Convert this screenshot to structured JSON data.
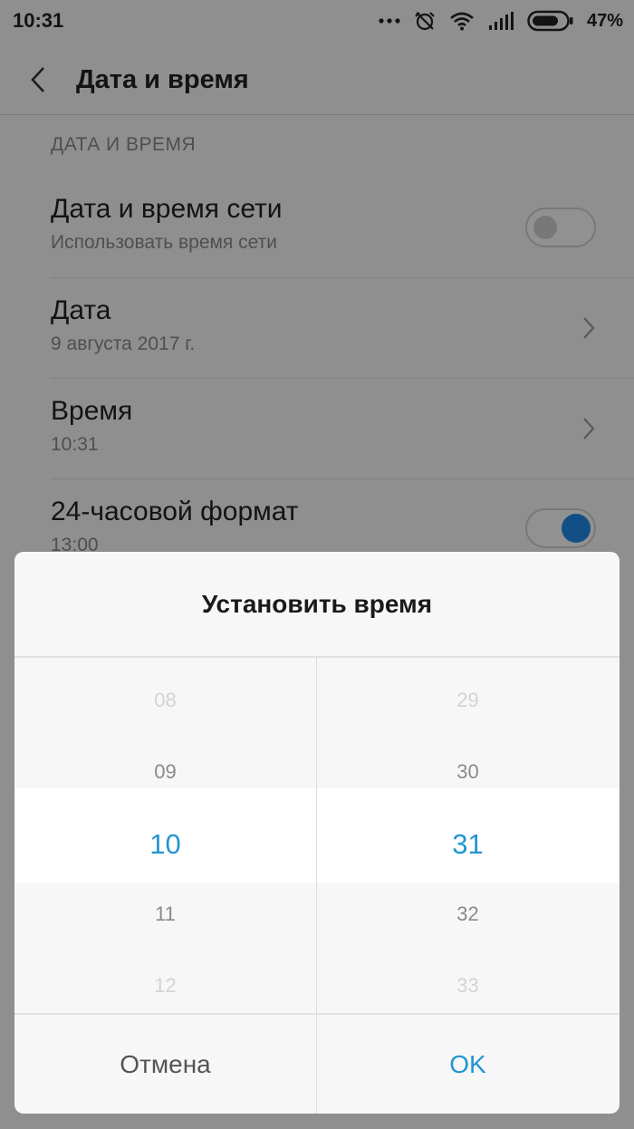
{
  "status_bar": {
    "time": "10:31",
    "battery": "47%"
  },
  "app_bar": {
    "title": "Дата и время"
  },
  "section": {
    "header": "ДАТА И ВРЕМЯ"
  },
  "rows": [
    {
      "title": "Дата и время сети",
      "subtitle": "Использовать время сети",
      "toggle": "off"
    },
    {
      "title": "Дата",
      "subtitle": "9 августа 2017 г."
    },
    {
      "title": "Время",
      "subtitle": "10:31"
    },
    {
      "title": "24-часовой формат",
      "subtitle": "13:00",
      "toggle": "on"
    }
  ],
  "dialog": {
    "title": "Установить время",
    "hours": [
      "08",
      "09",
      "10",
      "11",
      "12"
    ],
    "minutes": [
      "29",
      "30",
      "31",
      "32",
      "33"
    ],
    "selected_hour": "10",
    "selected_minute": "31",
    "cancel_label": "Отмена",
    "ok_label": "OK"
  },
  "colors": {
    "accent": "#2196d3",
    "toggle_on": "#1e88e5"
  }
}
